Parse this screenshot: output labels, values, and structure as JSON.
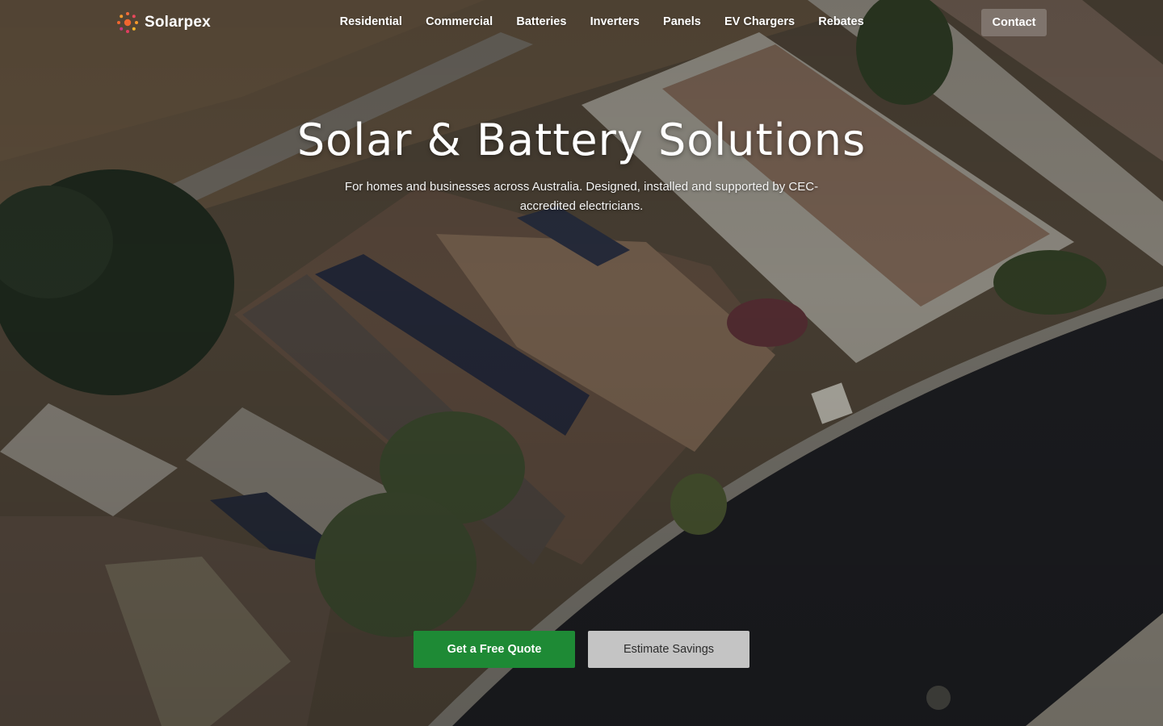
{
  "brand": {
    "name": "Solarpex",
    "logo_icon": "sun-burst-icon"
  },
  "nav": {
    "items": [
      {
        "label": "Residential"
      },
      {
        "label": "Commercial"
      },
      {
        "label": "Batteries"
      },
      {
        "label": "Inverters"
      },
      {
        "label": "Panels"
      },
      {
        "label": "EV Chargers"
      },
      {
        "label": "Rebates"
      }
    ],
    "contact_label": "Contact"
  },
  "hero": {
    "title": "Solar & Battery Solutions",
    "subtitle": "For homes and businesses across Australia. Designed, installed and supported by CEC-accredited electricians.",
    "primary_cta": "Get a Free Quote",
    "secondary_cta": "Estimate Savings",
    "background": "aerial-photo-houses-with-solar-panels"
  },
  "colors": {
    "primary_button": "#1e8a35",
    "secondary_button": "#c4c4c4",
    "logo_accent": "#f0662e"
  }
}
